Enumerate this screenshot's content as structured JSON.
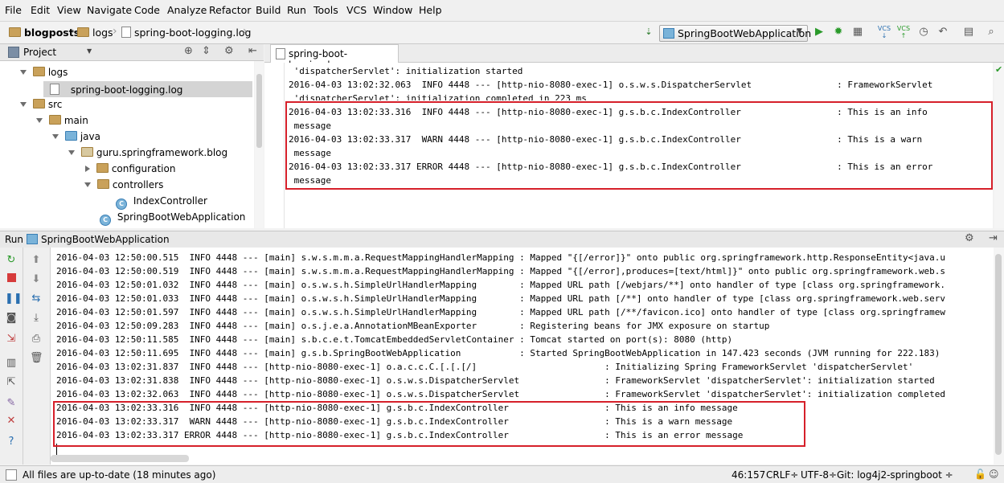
{
  "menu": [
    "File",
    "Edit",
    "View",
    "Navigate",
    "Code",
    "Analyze",
    "Refactor",
    "Build",
    "Run",
    "Tools",
    "VCS",
    "Window",
    "Help"
  ],
  "breadcrumb": {
    "project": "blogposts",
    "folder": "logs",
    "file": "spring-boot-logging.log"
  },
  "toolbar": {
    "run_config": "SpringBootWebApplication"
  },
  "project_panel": {
    "title": "Project",
    "tree": [
      {
        "label": "logs"
      },
      {
        "label": "spring-boot-logging.log"
      },
      {
        "label": "src"
      },
      {
        "label": "main"
      },
      {
        "label": "java"
      },
      {
        "label": "guru.springframework.blog"
      },
      {
        "label": "configuration"
      },
      {
        "label": "controllers"
      },
      {
        "label": "IndexController"
      },
      {
        "label": "SpringBootWebApplication"
      }
    ]
  },
  "editor": {
    "tab": "spring-boot-logging.log",
    "lines": [
      " 'dispatcherServlet': initialization started",
      "2016-04-03 13:02:32.063  INFO 4448 --- [http-nio-8080-exec-1] o.s.w.s.DispatcherServlet                : FrameworkServlet",
      " 'dispatcherServlet': initialization completed in 223 ms",
      "2016-04-03 13:02:33.316  INFO 4448 --- [http-nio-8080-exec-1] g.s.b.c.IndexController                  : This is an info",
      " message",
      "2016-04-03 13:02:33.317  WARN 4448 --- [http-nio-8080-exec-1] g.s.b.c.IndexController                  : This is a warn",
      " message",
      "2016-04-03 13:02:33.317 ERROR 4448 --- [http-nio-8080-exec-1] g.s.b.c.IndexController                  : This is an error",
      " message"
    ]
  },
  "run_panel": {
    "label": "Run",
    "config": "SpringBootWebApplication",
    "lines": [
      "2016-04-03 12:50:00.515  INFO 4448 --- [main] s.w.s.m.m.a.RequestMappingHandlerMapping : Mapped \"{[/error]}\" onto public org.springframework.http.ResponseEntity<java.u",
      "2016-04-03 12:50:00.519  INFO 4448 --- [main] s.w.s.m.m.a.RequestMappingHandlerMapping : Mapped \"{[/error],produces=[text/html]}\" onto public org.springframework.web.s",
      "2016-04-03 12:50:01.032  INFO 4448 --- [main] o.s.w.s.h.SimpleUrlHandlerMapping        : Mapped URL path [/webjars/**] onto handler of type [class org.springframework.",
      "2016-04-03 12:50:01.033  INFO 4448 --- [main] o.s.w.s.h.SimpleUrlHandlerMapping        : Mapped URL path [/**] onto handler of type [class org.springframework.web.serv",
      "2016-04-03 12:50:01.597  INFO 4448 --- [main] o.s.w.s.h.SimpleUrlHandlerMapping        : Mapped URL path [/**/favicon.ico] onto handler of type [class org.springframew",
      "2016-04-03 12:50:09.283  INFO 4448 --- [main] o.s.j.e.a.AnnotationMBeanExporter        : Registering beans for JMX exposure on startup",
      "2016-04-03 12:50:11.585  INFO 4448 --- [main] s.b.c.e.t.TomcatEmbeddedServletContainer : Tomcat started on port(s): 8080 (http)",
      "2016-04-03 12:50:11.695  INFO 4448 --- [main] g.s.b.SpringBootWebApplication           : Started SpringBootWebApplication in 147.423 seconds (JVM running for 222.183)",
      "2016-04-03 13:02:31.837  INFO 4448 --- [http-nio-8080-exec-1] o.a.c.c.C.[.[.[/]                        : Initializing Spring FrameworkServlet 'dispatcherServlet'",
      "2016-04-03 13:02:31.838  INFO 4448 --- [http-nio-8080-exec-1] o.s.w.s.DispatcherServlet                : FrameworkServlet 'dispatcherServlet': initialization started",
      "2016-04-03 13:02:32.063  INFO 4448 --- [http-nio-8080-exec-1] o.s.w.s.DispatcherServlet                : FrameworkServlet 'dispatcherServlet': initialization completed",
      "2016-04-03 13:02:33.316  INFO 4448 --- [http-nio-8080-exec-1] g.s.b.c.IndexController                  : This is an info message",
      "2016-04-03 13:02:33.317  WARN 4448 --- [http-nio-8080-exec-1] g.s.b.c.IndexController                  : This is a warn message",
      "2016-04-03 13:02:33.317 ERROR 4448 --- [http-nio-8080-exec-1] g.s.b.c.IndexController                  : This is an error message"
    ]
  },
  "status": {
    "message": "All files are up-to-date (18 minutes ago)",
    "position": "46:157",
    "line_sep": "CRLF÷",
    "encoding": "UTF-8÷",
    "git": "Git: log4j2-springboot ÷"
  },
  "colors": {
    "highlight_box": "#d6202a",
    "folder": "#c9a15a",
    "run_green": "#2a9a2a"
  }
}
